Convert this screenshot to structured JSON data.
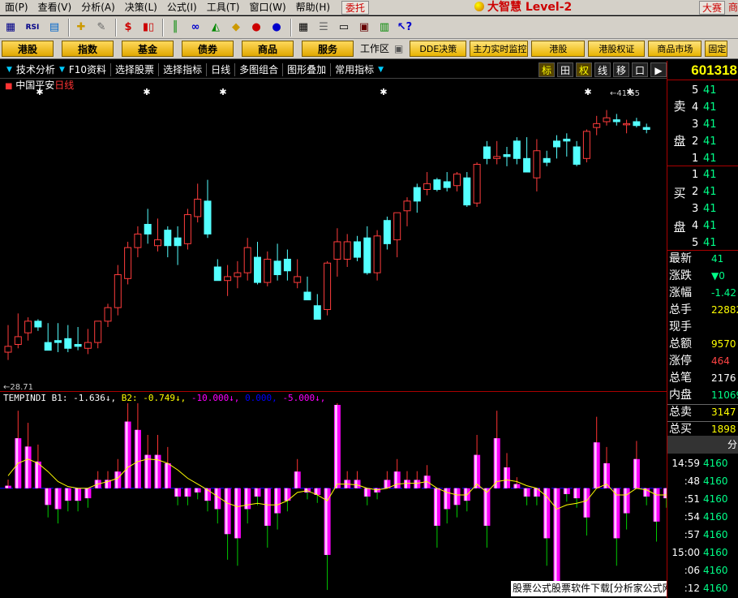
{
  "menu": {
    "items": [
      "面(P)",
      "查看(V)",
      "分析(A)",
      "决策(L)",
      "公式(I)",
      "工具(T)",
      "窗口(W)",
      "帮助(H)"
    ],
    "weituo": "委托",
    "brand": "大智慧 Level-2",
    "dasai": "大赛",
    "shang": "商"
  },
  "toolbar": {
    "icons": [
      "grid-icon",
      "rsi-icon",
      "calculator-icon",
      "move-icon",
      "pencil-icon",
      "dollar-icon",
      "kline-icon",
      "bars-icon",
      "binoculars-icon",
      "bell-icon",
      "diamond-icon",
      "red-circle-icon",
      "blue-circle-icon",
      "grid-table-icon",
      "list-icon",
      "screen-icon",
      "window-icon",
      "book-icon",
      "help-cursor-icon"
    ],
    "rsi_label": "RSI",
    "dollar_label": "$"
  },
  "nav": {
    "buttons": [
      "港股",
      "指数",
      "基金",
      "债券",
      "商品",
      "服务"
    ],
    "gongzuo": "工作区",
    "buttons2": [
      "DDE决策",
      "主力实时监控",
      "港股",
      "港股权证",
      "商品市场",
      "固定"
    ]
  },
  "tabs": {
    "items": [
      "技术分析",
      "F10资料",
      "选择股票",
      "选择指标",
      "日线",
      "多图组合",
      "图形叠加",
      "常用指标"
    ],
    "icon_buttons": [
      "标",
      "田",
      "权",
      "线",
      "移",
      "口",
      "▶"
    ]
  },
  "stock": {
    "name": "中国平安",
    "period": "日线",
    "code": "601318",
    "high_label": "41.65",
    "low_label": "28.71"
  },
  "indicator": {
    "name": "TEMPINDI",
    "b1": "B1: -1.636↓,",
    "b2": "B2: -0.749↓,",
    "c1": "-10.000↓,",
    "c2": "0.000,",
    "c3": "-5.000↓,"
  },
  "orderbook": {
    "sell_label_1": "卖",
    "sell_label_2": "盘",
    "buy_label_1": "买",
    "buy_label_2": "盘",
    "sell": [
      {
        "n": "5",
        "p": "41"
      },
      {
        "n": "4",
        "p": "41"
      },
      {
        "n": "3",
        "p": "41"
      },
      {
        "n": "2",
        "p": "41"
      },
      {
        "n": "1",
        "p": "41"
      }
    ],
    "buy": [
      {
        "n": "1",
        "p": "41"
      },
      {
        "n": "2",
        "p": "41"
      },
      {
        "n": "3",
        "p": "41"
      },
      {
        "n": "4",
        "p": "41"
      },
      {
        "n": "5",
        "p": "41"
      }
    ]
  },
  "stats": [
    {
      "label": "最新",
      "value": "41",
      "color": "#0f8"
    },
    {
      "label": "涨跌",
      "value": "▼0",
      "color": "#0f8"
    },
    {
      "label": "涨幅",
      "value": "-1.42",
      "color": "#0f8"
    },
    {
      "label": "总手",
      "value": "22882",
      "color": "#ff0"
    },
    {
      "label": "现手",
      "value": "",
      "color": "#ff0"
    },
    {
      "label": "总额",
      "value": "9570",
      "color": "#ff0"
    },
    {
      "label": "涨停",
      "value": "464",
      "color": "#f44"
    },
    {
      "label": "总笔",
      "value": "2176",
      "color": "#fff"
    },
    {
      "label": "内盘",
      "value": "11069",
      "color": "#0f8"
    },
    {
      "label": "总卖",
      "value": "3147",
      "color": "#ff0"
    },
    {
      "label": "总买",
      "value": "1898",
      "color": "#ff0"
    }
  ],
  "ticks": {
    "header": "分",
    "rows": [
      {
        "t": "14:59",
        "p": "4160"
      },
      {
        "t": ":48",
        "p": "4160"
      },
      {
        "t": ":51",
        "p": "4160"
      },
      {
        "t": ":54",
        "p": "4160"
      },
      {
        "t": ":57",
        "p": "4160"
      },
      {
        "t": "15:00",
        "p": "4160"
      },
      {
        "t": ":06",
        "p": "4160"
      },
      {
        "t": ":12",
        "p": "4160"
      }
    ]
  },
  "watermark": "股票公式股票软件下载[分析家公式网www.88gs.com]",
  "chart_data": {
    "type": "candlestick",
    "price_range": [
      27.5,
      43.0
    ],
    "candles": [
      {
        "o": 29.6,
        "h": 30.7,
        "l": 28.9,
        "c": 29.3,
        "dir": "up"
      },
      {
        "o": 29.7,
        "h": 31.3,
        "l": 29.5,
        "c": 30.1,
        "dir": "up"
      },
      {
        "o": 30.3,
        "h": 31.1,
        "l": 29.9,
        "c": 30.9,
        "dir": "up"
      },
      {
        "o": 30.9,
        "h": 31.0,
        "l": 30.4,
        "c": 30.6,
        "dir": "down"
      },
      {
        "o": 29.8,
        "h": 30.8,
        "l": 29.4,
        "c": 29.4,
        "dir": "down"
      },
      {
        "o": 29.8,
        "h": 30.8,
        "l": 29.3,
        "c": 29.9,
        "dir": "down"
      },
      {
        "o": 30.0,
        "h": 30.7,
        "l": 29.3,
        "c": 29.5,
        "dir": "down"
      },
      {
        "o": 29.6,
        "h": 30.6,
        "l": 29.4,
        "c": 29.7,
        "dir": "down"
      },
      {
        "o": 29.5,
        "h": 30.5,
        "l": 29.2,
        "c": 29.8,
        "dir": "up"
      },
      {
        "o": 29.8,
        "h": 30.7,
        "l": 29.5,
        "c": 30.9,
        "dir": "up"
      },
      {
        "o": 30.9,
        "h": 31.8,
        "l": 30.6,
        "c": 31.6,
        "dir": "up"
      },
      {
        "o": 31.6,
        "h": 33.8,
        "l": 31.2,
        "c": 33.3,
        "dir": "up"
      },
      {
        "o": 33.1,
        "h": 35.0,
        "l": 32.8,
        "c": 34.7,
        "dir": "up"
      },
      {
        "o": 34.7,
        "h": 35.8,
        "l": 34.2,
        "c": 35.4,
        "dir": "up"
      },
      {
        "o": 35.4,
        "h": 36.7,
        "l": 34.9,
        "c": 35.9,
        "dir": "down"
      },
      {
        "o": 35.1,
        "h": 36.2,
        "l": 34.5,
        "c": 34.8,
        "dir": "up"
      },
      {
        "o": 34.8,
        "h": 35.8,
        "l": 34.2,
        "c": 35.6,
        "dir": "down"
      },
      {
        "o": 34.8,
        "h": 35.8,
        "l": 33.8,
        "c": 35.2,
        "dir": "down"
      },
      {
        "o": 34.9,
        "h": 36.7,
        "l": 34.6,
        "c": 36.4,
        "dir": "up"
      },
      {
        "o": 36.3,
        "h": 38.0,
        "l": 36.0,
        "c": 37.2,
        "dir": "up"
      },
      {
        "o": 37.1,
        "h": 38.2,
        "l": 35.2,
        "c": 35.4,
        "dir": "down"
      },
      {
        "o": 33.7,
        "h": 34.1,
        "l": 33.0,
        "c": 33.0,
        "dir": "down"
      },
      {
        "o": 33.0,
        "h": 33.8,
        "l": 32.2,
        "c": 33.2,
        "dir": "up"
      },
      {
        "o": 33.2,
        "h": 34.0,
        "l": 32.6,
        "c": 33.4,
        "dir": "up"
      },
      {
        "o": 33.4,
        "h": 35.2,
        "l": 33.0,
        "c": 34.7,
        "dir": "up"
      },
      {
        "o": 34.2,
        "h": 35.0,
        "l": 32.8,
        "c": 32.9,
        "dir": "down"
      },
      {
        "o": 32.9,
        "h": 34.5,
        "l": 32.7,
        "c": 34.1,
        "dir": "up"
      },
      {
        "o": 34.0,
        "h": 34.9,
        "l": 33.0,
        "c": 33.3,
        "dir": "down"
      },
      {
        "o": 33.5,
        "h": 34.6,
        "l": 33.0,
        "c": 34.1,
        "dir": "down"
      },
      {
        "o": 33.2,
        "h": 34.1,
        "l": 32.6,
        "c": 32.9,
        "dir": "up"
      },
      {
        "o": 32.4,
        "h": 33.2,
        "l": 32.0,
        "c": 32.0,
        "dir": "down"
      },
      {
        "o": 31.7,
        "h": 32.3,
        "l": 31.2,
        "c": 31.0,
        "dir": "down"
      },
      {
        "o": 31.5,
        "h": 34.0,
        "l": 31.2,
        "c": 33.9,
        "dir": "up"
      },
      {
        "o": 34.1,
        "h": 35.7,
        "l": 33.2,
        "c": 35.0,
        "dir": "up"
      },
      {
        "o": 35.0,
        "h": 35.4,
        "l": 33.7,
        "c": 34.1,
        "dir": "up"
      },
      {
        "o": 34.2,
        "h": 35.3,
        "l": 34.0,
        "c": 35.0,
        "dir": "down"
      },
      {
        "o": 35.2,
        "h": 35.8,
        "l": 33.3,
        "c": 33.4,
        "dir": "down"
      },
      {
        "o": 33.4,
        "h": 35.6,
        "l": 33.0,
        "c": 35.3,
        "dir": "up"
      },
      {
        "o": 34.9,
        "h": 36.3,
        "l": 34.6,
        "c": 36.1,
        "dir": "down"
      },
      {
        "o": 35.1,
        "h": 36.5,
        "l": 34.2,
        "c": 36.5,
        "dir": "up"
      },
      {
        "o": 36.6,
        "h": 37.3,
        "l": 35.8,
        "c": 37.1,
        "dir": "up"
      },
      {
        "o": 37.1,
        "h": 38.0,
        "l": 36.5,
        "c": 37.8,
        "dir": "down"
      },
      {
        "o": 37.7,
        "h": 38.6,
        "l": 37.4,
        "c": 38.0,
        "dir": "up"
      },
      {
        "o": 37.7,
        "h": 38.3,
        "l": 37.6,
        "c": 38.2,
        "dir": "down"
      },
      {
        "o": 37.8,
        "h": 38.6,
        "l": 37.6,
        "c": 38.1,
        "dir": "down"
      },
      {
        "o": 37.9,
        "h": 38.6,
        "l": 37.6,
        "c": 38.5,
        "dir": "up"
      },
      {
        "o": 38.3,
        "h": 38.6,
        "l": 36.8,
        "c": 36.9,
        "dir": "down"
      },
      {
        "o": 37.0,
        "h": 39.1,
        "l": 36.8,
        "c": 39.0,
        "dir": "up"
      },
      {
        "o": 39.3,
        "h": 40.2,
        "l": 39.0,
        "c": 39.9,
        "dir": "down"
      },
      {
        "o": 39.3,
        "h": 40.2,
        "l": 39.0,
        "c": 39.4,
        "dir": "up"
      },
      {
        "o": 39.4,
        "h": 39.9,
        "l": 38.9,
        "c": 39.5,
        "dir": "down"
      },
      {
        "o": 40.2,
        "h": 40.4,
        "l": 39.0,
        "c": 39.3,
        "dir": "down"
      },
      {
        "o": 39.3,
        "h": 40.4,
        "l": 38.6,
        "c": 38.6,
        "dir": "down"
      },
      {
        "o": 38.3,
        "h": 40.3,
        "l": 37.6,
        "c": 39.7,
        "dir": "up"
      },
      {
        "o": 39.1,
        "h": 39.7,
        "l": 38.9,
        "c": 39.3,
        "dir": "down"
      },
      {
        "o": 39.9,
        "h": 40.5,
        "l": 39.3,
        "c": 40.2,
        "dir": "down"
      },
      {
        "o": 40.3,
        "h": 40.6,
        "l": 39.4,
        "c": 40.2,
        "dir": "down"
      },
      {
        "o": 39.9,
        "h": 40.2,
        "l": 38.9,
        "c": 39.0,
        "dir": "down"
      },
      {
        "o": 39.3,
        "h": 40.8,
        "l": 39.1,
        "c": 40.7,
        "dir": "up"
      },
      {
        "o": 40.9,
        "h": 41.5,
        "l": 40.5,
        "c": 41.1,
        "dir": "up"
      },
      {
        "o": 41.2,
        "h": 41.8,
        "l": 41.0,
        "c": 41.4,
        "dir": "up"
      },
      {
        "o": 41.3,
        "h": 41.6,
        "l": 41.0,
        "c": 41.2,
        "dir": "down"
      },
      {
        "o": 41.1,
        "h": 41.3,
        "l": 40.6,
        "c": 41.1,
        "dir": "up"
      },
      {
        "o": 41.2,
        "h": 41.4,
        "l": 40.9,
        "c": 41.0,
        "dir": "down"
      },
      {
        "o": 40.9,
        "h": 41.1,
        "l": 40.6,
        "c": 40.8,
        "dir": "down"
      }
    ],
    "indicator_range": [
      -12,
      10
    ],
    "indicator_bars": [
      0.3,
      6.0,
      5.0,
      3.2,
      -2.0,
      -2.5,
      -1.5,
      -1.5,
      -1.2,
      1.0,
      1.0,
      2.0,
      8.0,
      7.0,
      4.0,
      4.0,
      3.0,
      -1.0,
      -1.0,
      -0.5,
      -1.5,
      -2.5,
      -5.5,
      -6.0,
      -2.5,
      -1.0,
      -4.5,
      -3.0,
      -1.5,
      2.0,
      -0.5,
      -0.8,
      -8.0,
      10.0,
      1.0,
      1.0,
      -1.0,
      -0.5,
      1.0,
      2.0,
      1.0,
      1.0,
      1.5,
      -4.5,
      -2.5,
      -2.0,
      -1.5,
      4.0,
      -4.5,
      6.0,
      2.5,
      0.5,
      -1.0,
      -1.0,
      -6.0,
      -12.0,
      -0.7,
      -1.2,
      -3.5,
      5.5,
      3.0,
      -6.0,
      -3.0,
      3.5,
      -1.0,
      -4.0,
      -1.2,
      2.0,
      -5.0
    ],
    "ma_line": [
      1.5,
      3.0,
      3.5,
      3.0,
      2.0,
      0.8,
      0.2,
      0.0,
      0.0,
      0.5,
      0.8,
      1.2,
      2.5,
      3.2,
      3.5,
      3.4,
      3.0,
      2.2,
      1.2,
      0.5,
      -0.2,
      -1.0,
      -1.8,
      -2.2,
      -2.0,
      -1.8,
      -2.0,
      -2.0,
      -1.5,
      -0.5,
      -0.3,
      -0.8,
      -1.5,
      0.5,
      0.5,
      0.4,
      0.0,
      -0.2,
      0.0,
      0.5,
      0.6,
      0.6,
      0.8,
      0.0,
      -0.5,
      -0.8,
      -0.8,
      0.5,
      -0.5,
      0.8,
      1.0,
      0.8,
      0.3,
      0.0,
      -1.0,
      -2.5,
      -2.0,
      -1.8,
      -1.5,
      0.0,
      0.5,
      -0.8,
      -0.8,
      0.0,
      -0.2,
      -0.8,
      -0.8,
      -0.2,
      -1.0
    ]
  }
}
